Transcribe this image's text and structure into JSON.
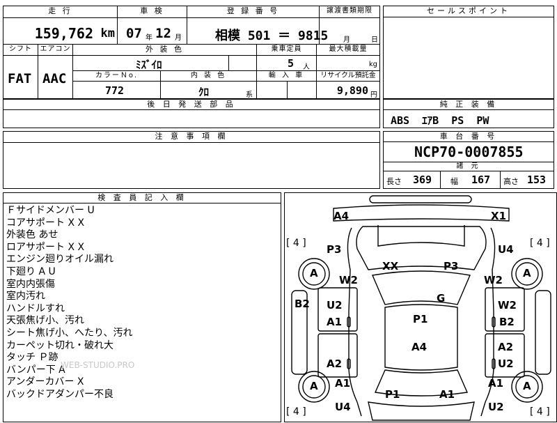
{
  "row1": {
    "mileage_label": "走 行",
    "mileage_value": "159,762",
    "mileage_unit": "km",
    "inspection_label": "車 検",
    "inspection_year": "07",
    "year_unit": "年",
    "inspection_month": "12",
    "month_unit": "月",
    "plate_label": "登 録 番 号",
    "plate_value": "相模 501 ＝ 9815",
    "transfer_label": "譲渡書類期限",
    "transfer_month": "月",
    "transfer_day": "日"
  },
  "row2": {
    "shift_label": "シフト",
    "shift_value": "FAT",
    "ac_label": "エアコン",
    "ac_value": "AAC",
    "exterior_label": "外 装 色",
    "exterior_value": "ﾐｽﾞｲﾛ",
    "capacity_label": "乗車定員",
    "capacity_value": "5",
    "capacity_unit": "人",
    "load_label": "最大積載量",
    "load_unit": "kg",
    "color_no_label": "カラーＮo.",
    "color_no_value": "772",
    "interior_label": "内 装 色",
    "interior_value": "ｸﾛ",
    "interior_unit": "系",
    "import_label": "輸 入 車",
    "recycle_label": "リサイクル預託金",
    "recycle_value": "9,890",
    "recycle_unit": "円"
  },
  "later_parts_label": "後 日 発 送 部 品",
  "sales_point_label": "セールスポイント",
  "equipment": {
    "label": "純 正 装 備",
    "value": "ABS  ｴｱB  PS  PW"
  },
  "caution_label": "注 意 事 項 欄",
  "chassis": {
    "label": "車 台 番 号",
    "value": "NCP70-0007855",
    "spec_label": "諸 元",
    "length_label": "長さ",
    "length_value": "369",
    "width_label": "幅",
    "width_value": "167",
    "height_label": "高さ",
    "height_value": "153"
  },
  "inspector": {
    "label": "検 査 員 記 入 欄",
    "notes": [
      "Ｆサイドメンバー U",
      "コアサポート X X",
      "外装色 あせ",
      "ロアサポート X X",
      "エンジン廻りオイル漏れ",
      "下廻り A U",
      "室内内張傷",
      "室内汚れ",
      "ハンドルすれ",
      "天張焦げ小、汚れ",
      "シート焦げ小、へたり、汚れ",
      "カーペット切れ・破れ大",
      "タッチ Ｐ跡",
      "バンパー下 A",
      "アンダーカバー X",
      "バックドアダンパー不良"
    ]
  },
  "watermark": "WEB-STUDIO.PRO",
  "diagram": {
    "tire_bracket": "[ 4 ]",
    "tire_mark": "A",
    "marks": {
      "front_left": "A4",
      "front_right": "X1",
      "hood_left": "P3",
      "hood_center": "XX",
      "hood_right": "P3",
      "fender_right": "U4",
      "left_w2": "W2",
      "right_w2": "W2",
      "left_b2": "B2",
      "roof": "G",
      "left_u2": "U2",
      "left_a1": "A1",
      "center_p1": "P1",
      "right_w2b": "W2",
      "right_b2": "B2",
      "center_a4": "A4",
      "right_a2": "A2",
      "left_a2": "A2",
      "right_u2": "U2",
      "rear_left_a1": "A1",
      "rear_right_a1": "A1",
      "rear_p1": "P1",
      "rear_a1": "A1",
      "rear_left_u4": "U4",
      "rear_right_u2": "U2"
    }
  }
}
